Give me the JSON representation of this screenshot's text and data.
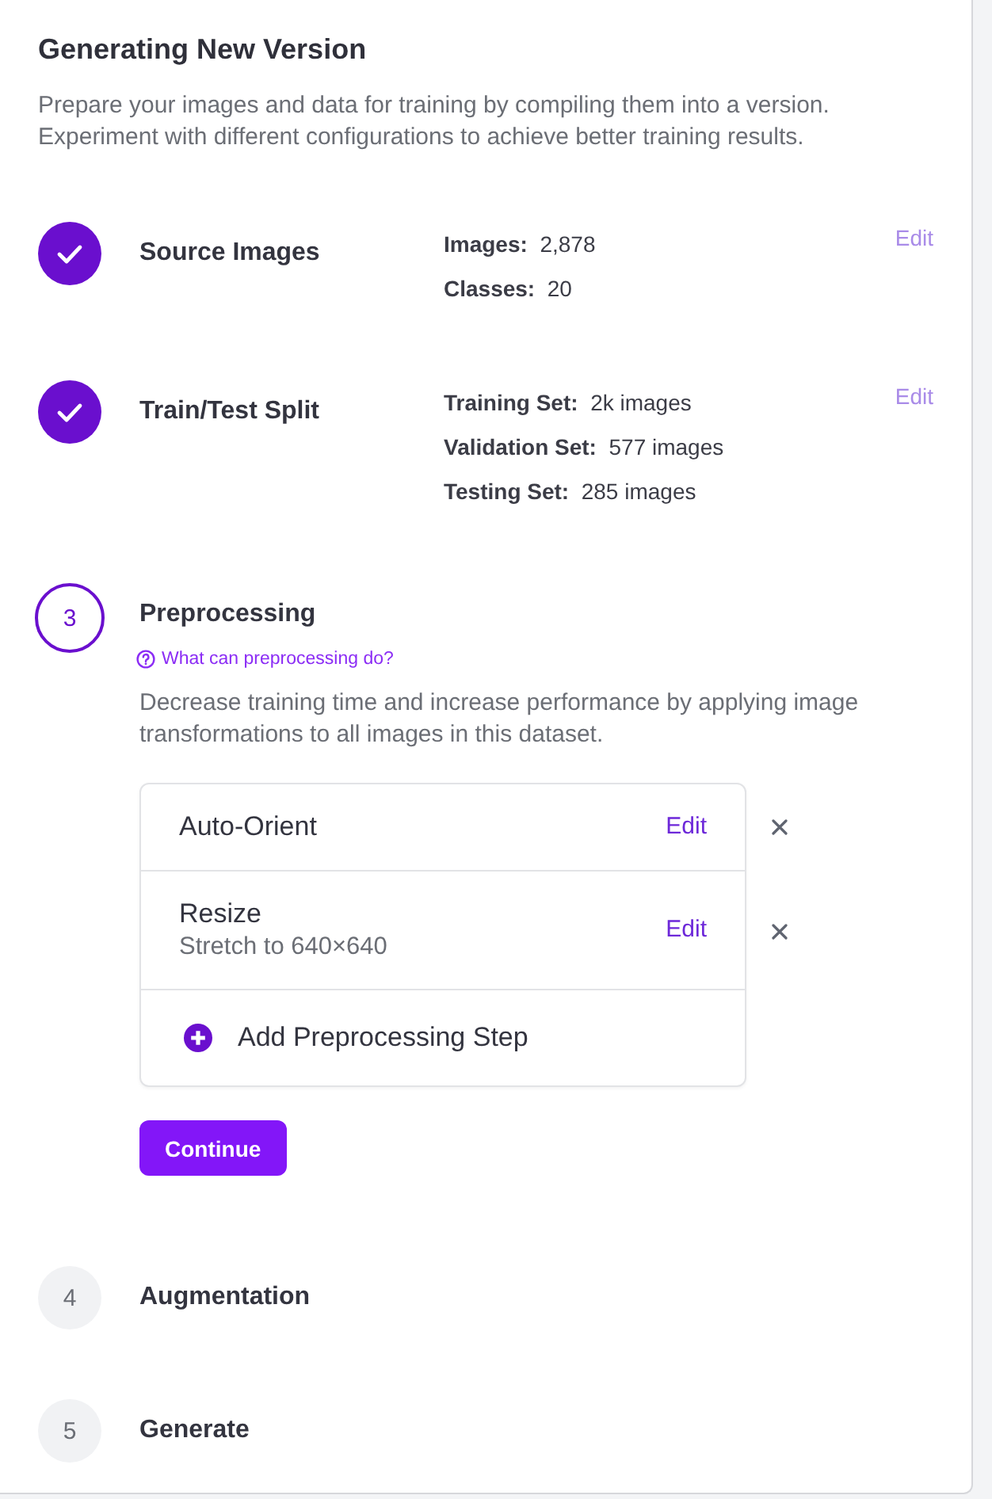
{
  "title": "Generating New Version",
  "description": "Prepare your images and data for training by compiling them into a version. Experiment with different configurations to achieve better training results.",
  "steps": [
    {
      "kind": "done",
      "title": "Source Images",
      "details": [
        {
          "label": "Images:",
          "value": "2,878"
        },
        {
          "label": "Classes:",
          "value": "20"
        }
      ],
      "edit": {
        "label": "Edit",
        "disabled": true
      }
    },
    {
      "kind": "done",
      "title": "Train/Test Split",
      "details": [
        {
          "label": "Training Set:",
          "value": "2k images"
        },
        {
          "label": "Validation Set:",
          "value": "577 images"
        },
        {
          "label": "Testing Set:",
          "value": "285 images"
        }
      ],
      "edit": {
        "label": "Edit",
        "disabled": true
      }
    },
    {
      "kind": "current",
      "number": "3",
      "title": "Preprocessing",
      "help_link": "What can preprocessing do?",
      "description": "Decrease training time and increase performance by applying image transformations to all images in this dataset.",
      "options": [
        {
          "name": "Auto-Orient",
          "edit": "Edit"
        },
        {
          "name": "Resize",
          "setting": "Stretch to 640×640",
          "edit": "Edit"
        }
      ],
      "add_button": "Add Preprocessing Step",
      "continue_button": "Continue"
    },
    {
      "kind": "pending",
      "number": "4",
      "title": "Augmentation"
    },
    {
      "kind": "pending",
      "number": "5",
      "title": "Generate"
    }
  ]
}
